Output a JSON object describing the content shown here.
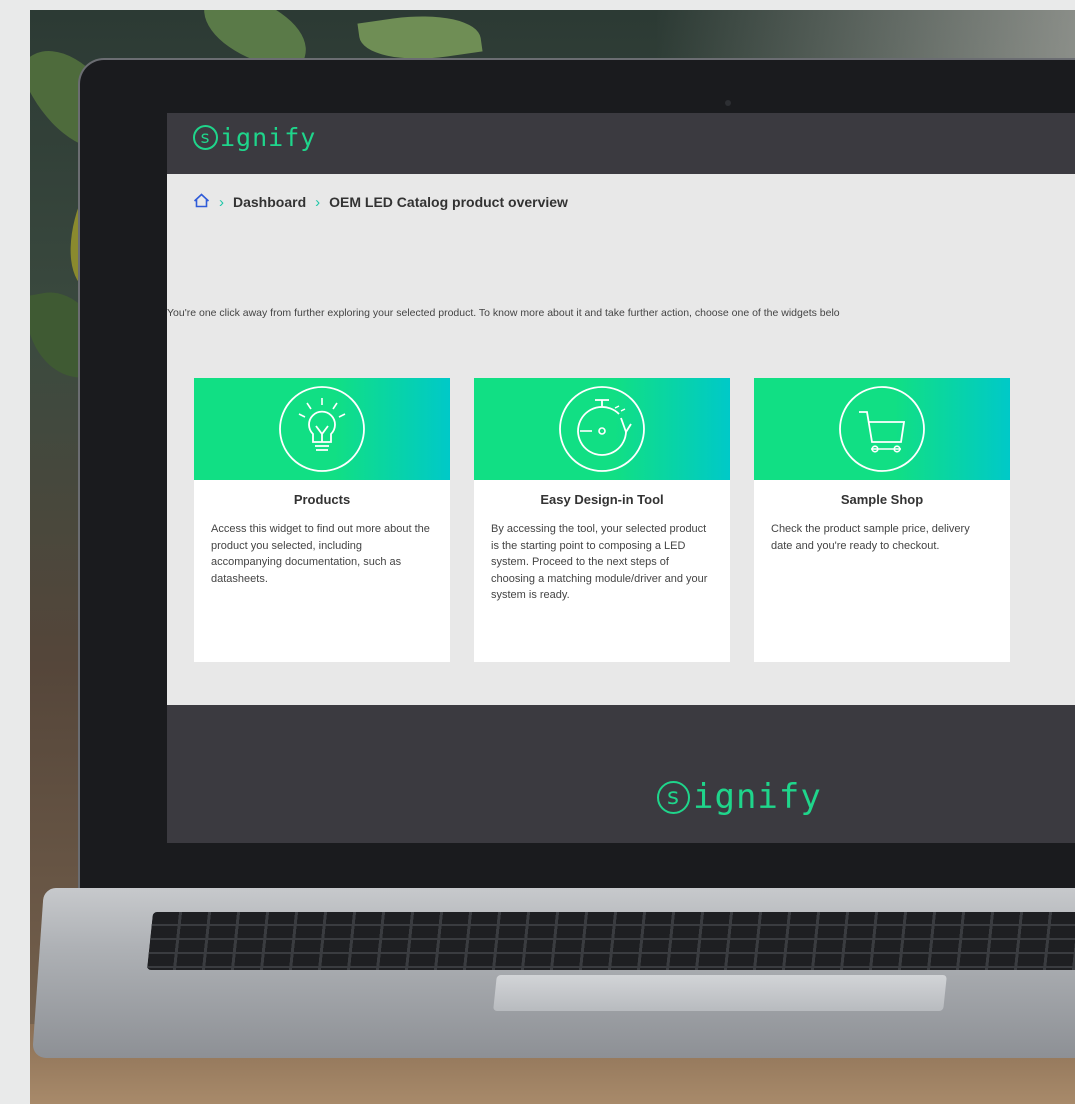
{
  "brand": {
    "logo_text": "ignify",
    "logo_mark": "s",
    "accent_color": "#1fd58b",
    "gradient_to": "#00c9c8"
  },
  "breadcrumb": {
    "home_icon": "home-icon",
    "items": [
      "Dashboard",
      "OEM LED Catalog product overview"
    ]
  },
  "intro_text": "You're one click away from further exploring your selected product. To know more about it and take further action, choose one of the widgets belo",
  "cards": [
    {
      "icon": "lightbulb-icon",
      "title": "Products",
      "description": "Access this widget to find out more about the product you selected, including accompanying documentation, such as datasheets."
    },
    {
      "icon": "stopwatch-icon",
      "title": "Easy Design-in Tool",
      "description": "By accessing the tool, your selected product is the starting point to composing a LED system. Proceed to the next steps of choosing a matching module/driver and your system is ready."
    },
    {
      "icon": "shopping-cart-icon",
      "title": "Sample Shop",
      "description": "Check the product sample price, delivery date and you're ready to checkout."
    }
  ]
}
